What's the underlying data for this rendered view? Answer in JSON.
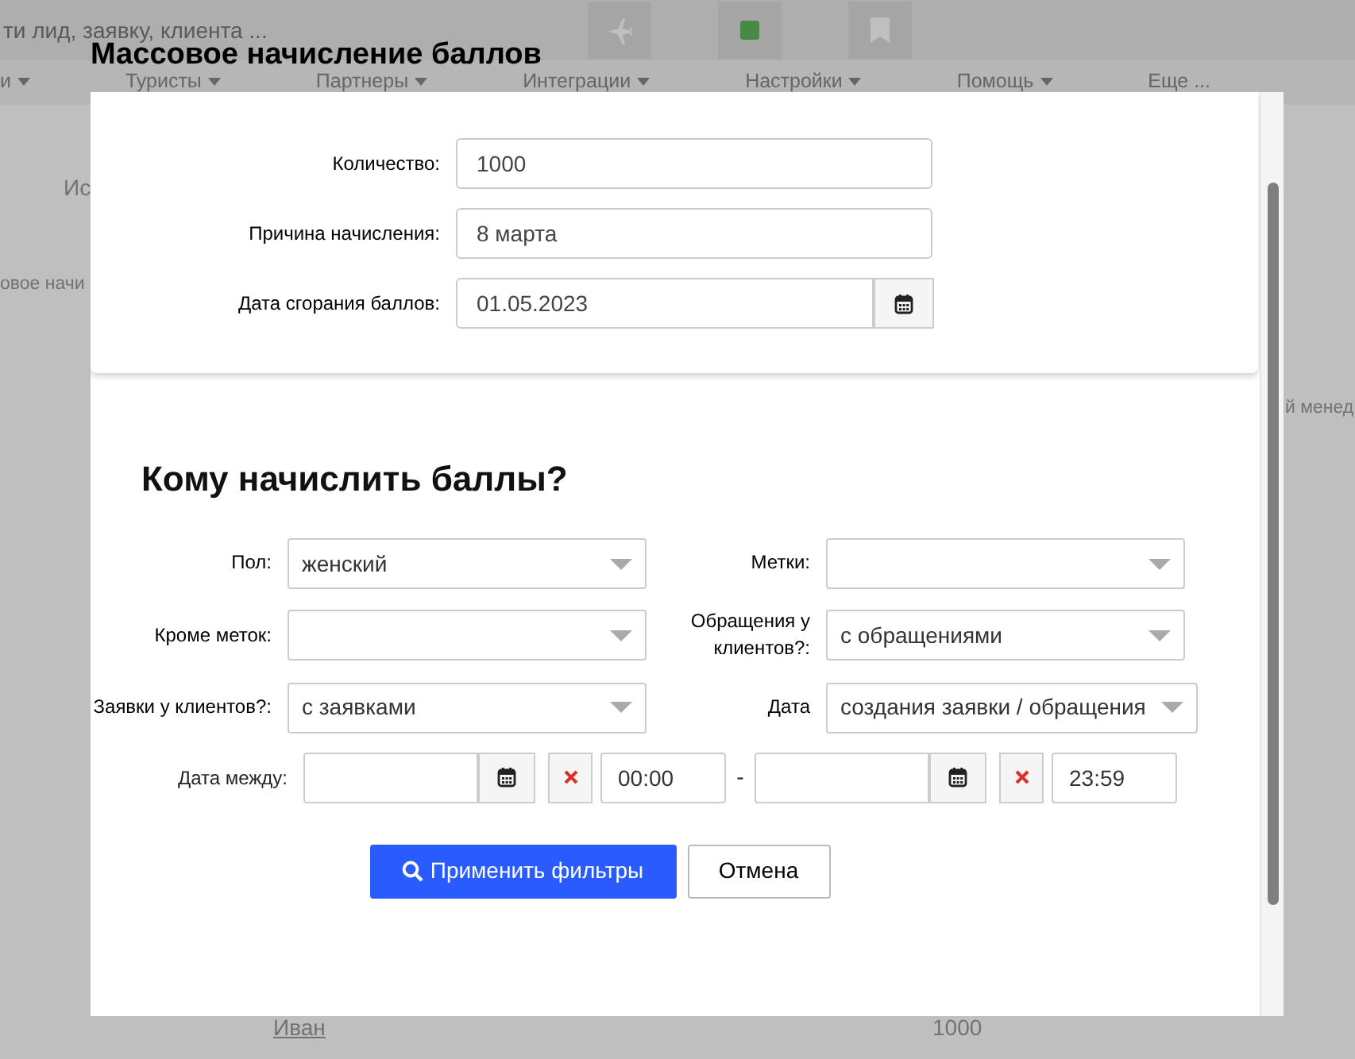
{
  "background": {
    "search_placeholder": "ти лид, заявку, клиента ...",
    "menu": [
      {
        "label": "и",
        "caret": true
      },
      {
        "label": "Туристы",
        "caret": true
      },
      {
        "label": "Партнеры",
        "caret": true
      },
      {
        "label": "Интеграции",
        "caret": true
      },
      {
        "label": "Настройки",
        "caret": true
      },
      {
        "label": "Помощь",
        "caret": true
      },
      {
        "label": "Еще ...",
        "caret": false
      }
    ],
    "texts": [
      {
        "kind": "tab",
        "text": "Ис"
      },
      {
        "kind": "field",
        "text": "овое начи"
      },
      {
        "kind": "header",
        "text": "й менед"
      },
      {
        "kind": "link",
        "text": "Иван"
      },
      {
        "kind": "cell",
        "text": "1000"
      }
    ]
  },
  "modal": {
    "title": "Массовое начисление баллов",
    "fields": [
      {
        "kind": "text",
        "label": "Количество:",
        "value": "1000"
      },
      {
        "kind": "text",
        "label": "Причина начисления:",
        "value": "8 марта"
      },
      {
        "kind": "date",
        "label": "Дата сгорания баллов:",
        "value": "01.05.2023"
      }
    ],
    "filter_title": "Кому начислить баллы?",
    "filters": [
      {
        "label": "Пол:",
        "value": "женский"
      },
      {
        "label": "Метки:"
      },
      {
        "label": "Кроме меток:"
      },
      {
        "label": "Обращения у клиентов?:",
        "value": "с обращениями"
      },
      {
        "label": "Заявки у клиентов?:",
        "value": "с заявками"
      }
    ],
    "date_type": {
      "label": "Дата",
      "value": "создания заявки / обращения"
    },
    "date_range": {
      "label": "Дата между:",
      "from_time": "00:00",
      "separator": "-",
      "to_time": "23:59"
    },
    "buttons": [
      {
        "kind": "primary",
        "label": "Применить фильтры"
      },
      {
        "kind": "secondary",
        "label": "Отмена"
      }
    ]
  }
}
